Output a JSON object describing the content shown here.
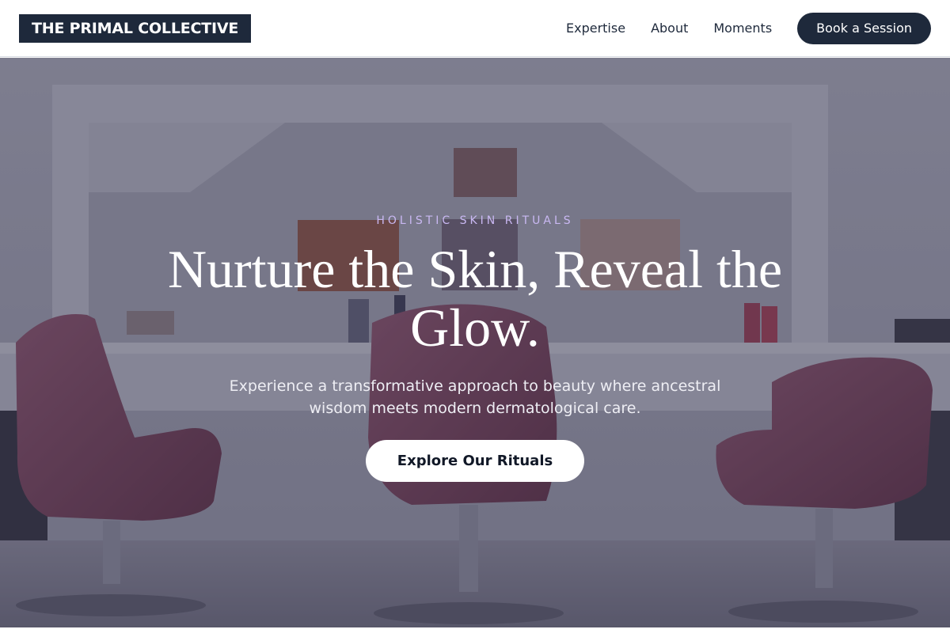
{
  "header": {
    "logo": "THE PRIMAL COLLECTIVE",
    "nav": [
      "Expertise",
      "About",
      "Moments"
    ],
    "cta_label": "Book a Session"
  },
  "hero": {
    "eyebrow": "HOLISTIC SKIN RITUALS",
    "headline": "Nurture the Skin, Reveal the Glow.",
    "subtext": "Experience a transformative approach to beauty where ancestral wisdom meets modern dermatological care.",
    "cta_label": "Explore Our Rituals",
    "background_image": "salon-interior-photo"
  },
  "colors": {
    "brand_navy": "#1e293b",
    "eyebrow_accent": "#c9b8f2",
    "chair_plum": "#8a4f66"
  }
}
